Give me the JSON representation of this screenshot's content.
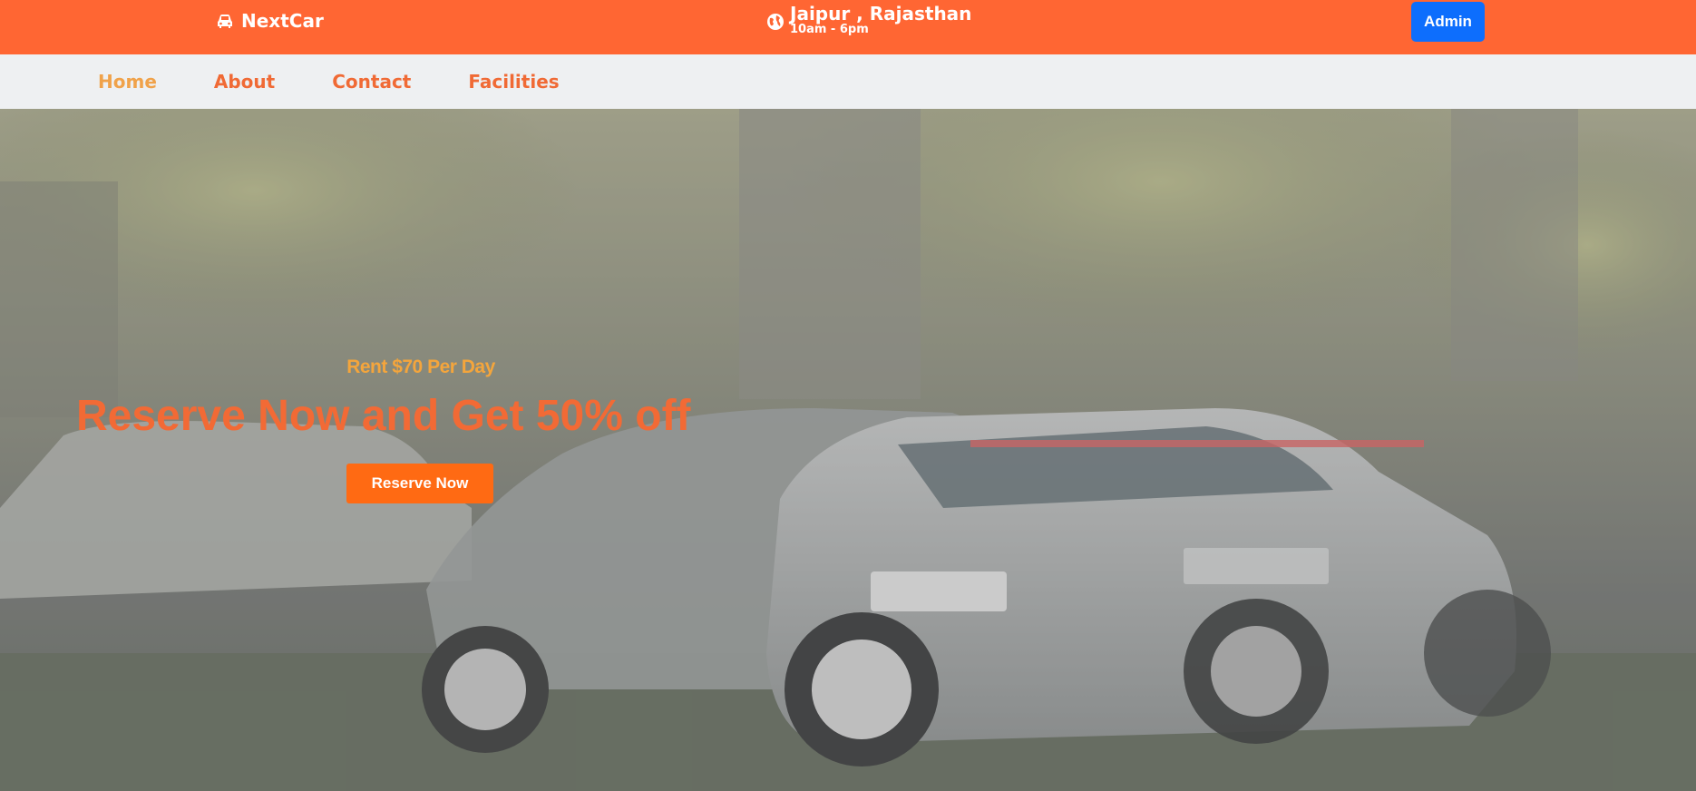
{
  "header": {
    "brand": "NextCar",
    "brand_icon": "car-icon",
    "location_icon": "globe-icon",
    "location_city": "Jaipur , Rajasthan",
    "location_hours": "10am - 6pm",
    "admin_label": "Admin"
  },
  "nav": {
    "items": [
      {
        "label": "Home",
        "active": true
      },
      {
        "label": "About",
        "active": false
      },
      {
        "label": "Contact",
        "active": false
      },
      {
        "label": "Facilities",
        "active": false
      }
    ]
  },
  "hero": {
    "subtitle": "Rent $70 Per Day",
    "title": "Reserve Now and Get 50% off",
    "button_label": "Reserve Now",
    "background": "cars-photo"
  },
  "colors": {
    "topbar": "#ff6633",
    "admin_button": "#0d6efd",
    "nav_background": "#eef0f2",
    "nav_text": "#f06a35",
    "nav_active": "#f0a24a",
    "hero_title": "#f26a35",
    "hero_subtitle": "#f4a53c",
    "reserve_button": "#ff6a13"
  }
}
